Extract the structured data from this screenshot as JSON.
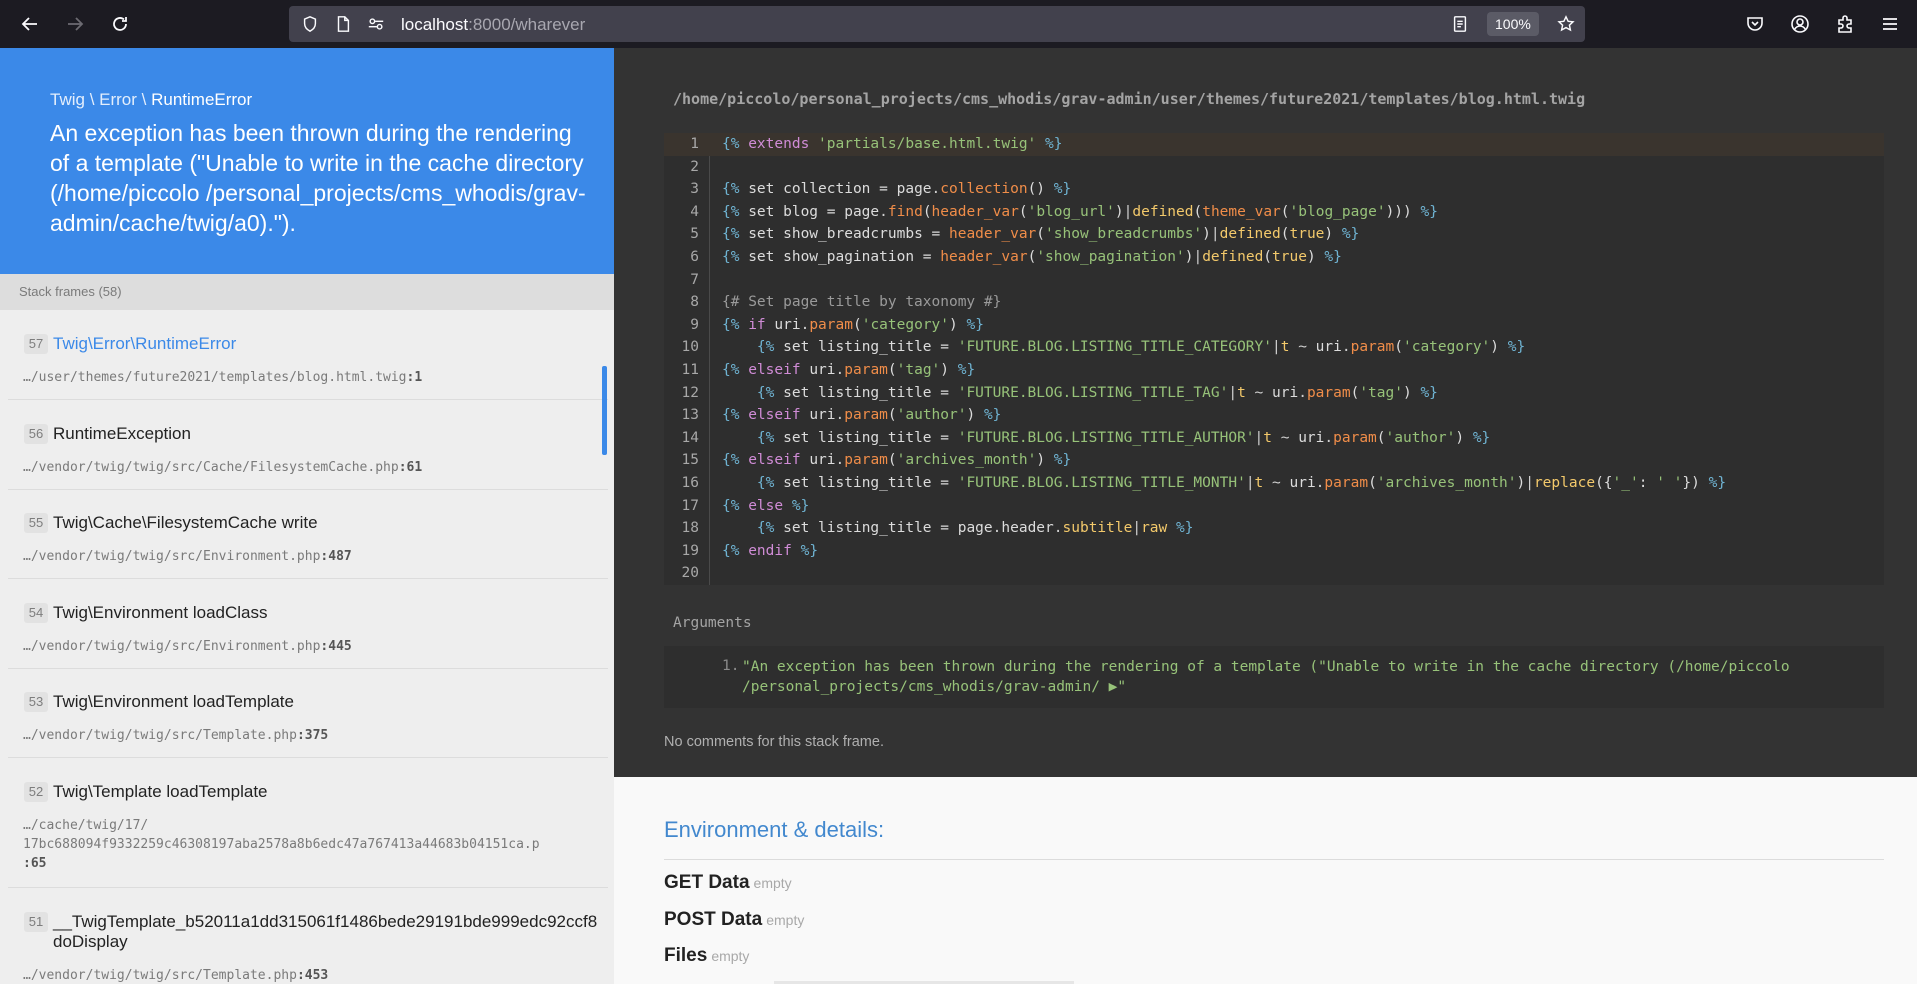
{
  "browser": {
    "url_host": "localhost",
    "url_rest": ":8000/wharever",
    "zoom": "100%"
  },
  "exception": {
    "namespace_1": "Twig",
    "namespace_2": "Error",
    "class": "RuntimeError",
    "message": "An exception has been thrown during the rendering of a template (\"Unable to write in the cache directory (/home/piccolo /personal_projects/cms_whodis/grav-admin/cache/twig/a0).\")."
  },
  "frames_header": "Stack frames (58)",
  "frames": [
    {
      "num": "57",
      "name": "Twig\\Error\\RuntimeError",
      "file": "…/user/themes/future2021/templates/blog.html.twig",
      "line": ":1"
    },
    {
      "num": "56",
      "name": "RuntimeException",
      "file": "…/vendor/twig/twig/src/Cache/FilesystemCache.php",
      "line": ":61"
    },
    {
      "num": "55",
      "name": "Twig\\Cache\\FilesystemCache write",
      "file": "…/vendor/twig/twig/src/Environment.php",
      "line": ":487"
    },
    {
      "num": "54",
      "name": "Twig\\Environment loadClass",
      "file": "…/vendor/twig/twig/src/Environment.php",
      "line": ":445"
    },
    {
      "num": "53",
      "name": "Twig\\Environment loadTemplate",
      "file": "…/vendor/twig/twig/src/Template.php",
      "line": ":375"
    },
    {
      "num": "52",
      "name": "Twig\\Template loadTemplate",
      "file": "…/cache/twig/17/",
      "file_2": "17bc688094f9332259c46308197aba2578a8b6edc47a767413a44683b04151ca.p",
      "line": ":65"
    },
    {
      "num": "51",
      "name": "__TwigTemplate_b52011a1dd315061f1486bede29191bde999edc92ccf8",
      "name_2": "doDisplay",
      "file": "…/vendor/twig/twig/src/Template.php",
      "line": ":453"
    }
  ],
  "code": {
    "file_path": "/home/piccolo/personal_projects/cms_whodis/grav-admin/user/themes/future2021/templates/blog.html.twig",
    "line_numbers": [
      "1",
      "2",
      "3",
      "4",
      "5",
      "6",
      "7",
      "8",
      "9",
      "10",
      "11",
      "12",
      "13",
      "14",
      "15",
      "16",
      "17",
      "18",
      "19",
      "20"
    ],
    "args_label": "Arguments",
    "arg_index": "1.",
    "arg_value_line1": "\"An exception has been thrown during the rendering of a template (\"Unable to write in the cache directory (/home/piccolo",
    "arg_value_line2": "/personal_projects/cms_whodis/grav-admin/ ▶\"",
    "no_comments": "No comments for this stack frame."
  },
  "environment": {
    "title": "Environment & details:",
    "rows": [
      {
        "label": "GET Data",
        "value": "empty"
      },
      {
        "label": "POST Data",
        "value": "empty"
      },
      {
        "label": "Files",
        "value": "empty"
      }
    ]
  }
}
